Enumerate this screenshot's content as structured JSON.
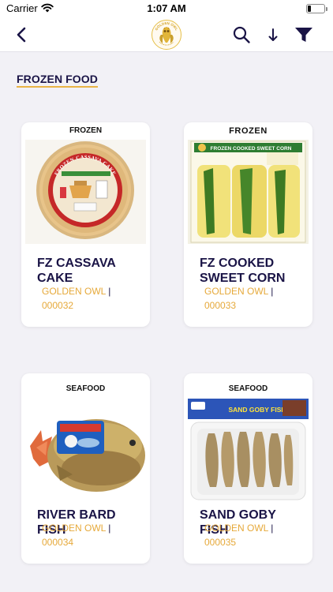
{
  "status_bar": {
    "carrier": "Carrier",
    "time": "1:07 AM"
  },
  "navbar": {
    "logo_text": "GOLDEN OWL",
    "icons": [
      "back-chevron-icon",
      "search-icon",
      "sort-down-arrow-icon",
      "filter-funnel-icon"
    ]
  },
  "section": {
    "title": "FROZEN FOOD"
  },
  "products": [
    {
      "tag": "FROZEN",
      "name": "FZ CASSAVA CAKE",
      "brand": "GOLDEN OWL",
      "separator": "|",
      "code": "000032",
      "photo_text": "FROZEN CASSAVA CAKE"
    },
    {
      "tag": "FROZEN",
      "name": "FZ COOKED SWEET CORN",
      "brand": "GOLDEN OWL",
      "separator": "|",
      "code": "000033",
      "photo_text": "FROZEN COOKED SWEET CORN"
    },
    {
      "tag": "SEAFOOD",
      "name": "RIVER BARD FISH",
      "brand": "GOLDEN OWL",
      "separator": "|",
      "code": "000034",
      "photo_text": ""
    },
    {
      "tag": "SEAFOOD",
      "name": "SAND GOBY FISH",
      "brand": "GOLDEN OWL",
      "separator": "|",
      "code": "000035",
      "photo_text": "SAND GOBY FISH"
    }
  ],
  "colors": {
    "title_navy": "#1a1446",
    "brand_gold": "#e6a93a",
    "underline": "#e9b445",
    "background": "#f2f1f6"
  }
}
